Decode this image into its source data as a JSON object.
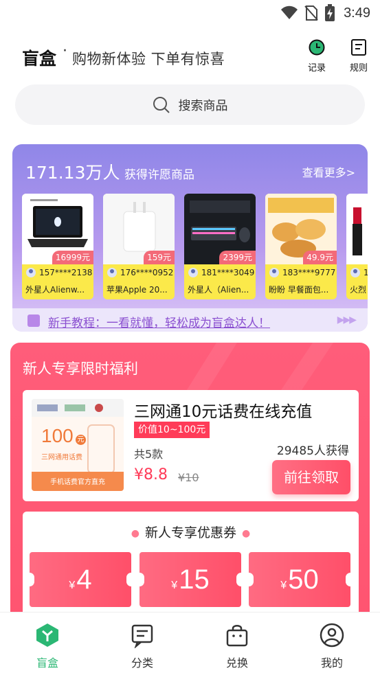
{
  "status_bar": {
    "time": "3:49"
  },
  "header": {
    "brand": "盲盒",
    "separator": "·",
    "slogan": "购物新体验  下单有惊喜",
    "records_label": "记录",
    "rules_label": "规则"
  },
  "search": {
    "placeholder": "搜索商品"
  },
  "wish": {
    "count": "171.13万人",
    "description": "获得许愿商品",
    "more": "查看更多>",
    "cards": [
      {
        "price": "16999元",
        "user": "157****2138",
        "name": "外星人Alienw..."
      },
      {
        "price": "159元",
        "user": "176****0952",
        "name": "苹果Apple 20..."
      },
      {
        "price": "2399元",
        "user": "181****3049",
        "name": "外星人（Alien..."
      },
      {
        "price": "49.9元",
        "user": "183****9777",
        "name": "盼盼 早餐面包..."
      },
      {
        "price": "",
        "user": "1",
        "name": "火烈"
      }
    ],
    "tutorial": "新手教程：一看就懂，轻松成为盲盒达人！"
  },
  "newbie": {
    "title": "新人专享限时福利",
    "offer": {
      "title": "三网通10元话费在线充值",
      "tag": "价值10~100元",
      "count": "共5款",
      "price": "¥8.8",
      "old_price": "¥10",
      "got": "29485人获得",
      "button": "前往领取",
      "img_text_main": "100",
      "img_text_unit": "元",
      "img_text_sub": "三网通用话费",
      "img_text_band": "手机话费官方直充"
    },
    "coupons_title": "新人专享优惠券",
    "coupons": [
      {
        "yen": "¥",
        "amount": "4"
      },
      {
        "yen": "¥",
        "amount": "15"
      },
      {
        "yen": "¥",
        "amount": "50"
      }
    ]
  },
  "tabbar": {
    "tabs": [
      {
        "label": "盲盒",
        "active": true
      },
      {
        "label": "分类",
        "active": false
      },
      {
        "label": "兑换",
        "active": false
      },
      {
        "label": "我的",
        "active": false
      }
    ]
  },
  "colors": {
    "accent_green": "#2bb774",
    "accent_red": "#ff4f68",
    "wish_purple": "#8f86e8",
    "card_yellow": "#fbe94a"
  }
}
